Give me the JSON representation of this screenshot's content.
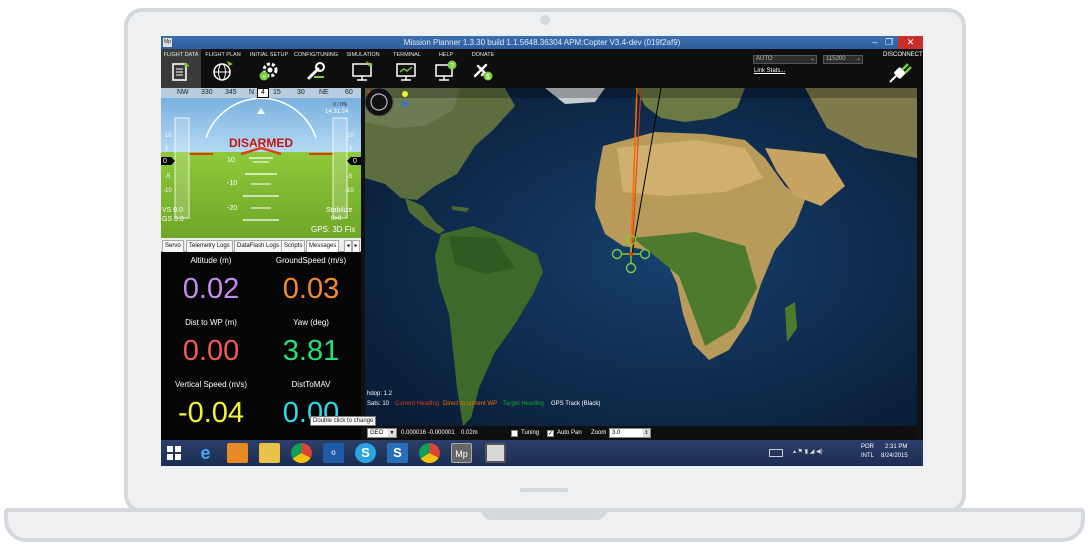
{
  "window": {
    "title": "Mission Planner 1.3.30 build 1.1.5648.36304 APM:Copter V3.4-dev (019f2af9)",
    "app_icon_text": "Mp"
  },
  "toolbar": {
    "tabs": [
      {
        "label": "FLIGHT DATA",
        "icon": "flight-data-icon"
      },
      {
        "label": "FLIGHT PLAN",
        "icon": "globe-icon"
      },
      {
        "label": "INITIAL SETUP",
        "icon": "setup-gear-icon"
      },
      {
        "label": "CONFIG/TUNING",
        "icon": "wrench-icon"
      },
      {
        "label": "SIMULATION",
        "icon": "simulation-monitor-icon"
      },
      {
        "label": "TERMINAL",
        "icon": "terminal-monitor-icon"
      },
      {
        "label": "HELP",
        "icon": "help-monitor-icon"
      },
      {
        "label": "DONATE",
        "icon": "donate-plane-icon"
      }
    ],
    "port_select": "AUTO",
    "baud_select": "115200",
    "link_stats": "Link Stats...",
    "connect_label": "DISCONNECT"
  },
  "hud": {
    "compass": [
      "NW",
      "330",
      "345",
      "N",
      "15",
      "30",
      "NE",
      "60"
    ],
    "heading_box": "4",
    "status": "DISARMED",
    "pitch_labels": [
      "10",
      "-10",
      "-20"
    ],
    "left_scale": [
      "10",
      "5",
      "0",
      "-5",
      "-10"
    ],
    "right_scale": [
      "10",
      "5",
      "0",
      "-5",
      "-10"
    ],
    "left_value": "0",
    "right_value": "0",
    "time": "14:31:24",
    "battery": "0 / 0%",
    "vs": "VS 0.0",
    "gs": "GS 0.0",
    "mode": "Stabilize",
    "armed_num": "0>0",
    "gps": "GPS: 3D Fix"
  },
  "tabs": [
    "Servo",
    "Telemetry Logs",
    "DataFlash Logs",
    "Scripts",
    "Messages"
  ],
  "quick": [
    {
      "label": "Altitude (m)",
      "value": "0.02",
      "color": "#c58cf0"
    },
    {
      "label": "GroundSpeed (m/s)",
      "value": "0.03",
      "color": "#f48a32"
    },
    {
      "label": "Dist to WP (m)",
      "value": "0.00",
      "color": "#f25a5a"
    },
    {
      "label": "Yaw (deg)",
      "value": "3.81",
      "color": "#22e07a"
    },
    {
      "label": "Vertical Speed (m/s)",
      "value": "-0.04",
      "color": "#f2f23a"
    },
    {
      "label": "DistToMAV",
      "value": "0.00",
      "color": "#2fd9e8"
    }
  ],
  "tooltip": "Double click to change",
  "map": {
    "hdop": "hdop: 1.2",
    "sats": "Sats: 10",
    "legend": [
      {
        "text": "Current Heading",
        "color": "#e23b1a"
      },
      {
        "text": "Direct to current WP",
        "color": "#ff6a00"
      },
      {
        "text": "Target Heading",
        "color": "#1aa32b"
      },
      {
        "text": "GPS Track (Black)",
        "color": "#ffffff"
      }
    ]
  },
  "mapbar": {
    "coord_mode": "GEO",
    "coords": "0.000016 -0.000001",
    "alt": "0.02m",
    "tuning": "Tuning",
    "autopan": "Auto Pan",
    "zoom_label": "Zoom",
    "zoom_value": "3.0"
  },
  "taskbar": {
    "lang": "POR",
    "layout": "INTL",
    "time": "2:31 PM",
    "date": "8/24/2015"
  },
  "colors": {
    "sky": "#9cc8ea",
    "ground": "#84bd2f",
    "disarmed": "#c21414",
    "titlebar": "#3c6fb0"
  }
}
